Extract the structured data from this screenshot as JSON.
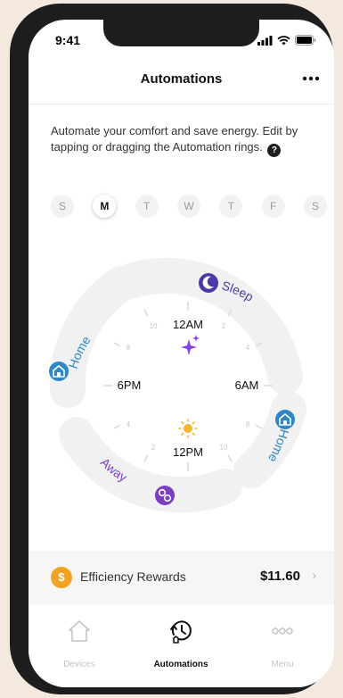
{
  "status_bar": {
    "time": "9:41"
  },
  "header": {
    "title": "Automations"
  },
  "intro": {
    "text": "Automate your comfort and save energy. Edit by tapping or dragging the Automation rings.",
    "help": "?"
  },
  "days": [
    {
      "label": "S",
      "active": false
    },
    {
      "label": "M",
      "active": true
    },
    {
      "label": "T",
      "active": false
    },
    {
      "label": "W",
      "active": false
    },
    {
      "label": "T",
      "active": false
    },
    {
      "label": "F",
      "active": false
    },
    {
      "label": "S",
      "active": false
    }
  ],
  "clock": {
    "labels": {
      "top": "12AM",
      "left": "6PM",
      "right": "6AM",
      "bottom": "12PM"
    },
    "hour_ticks": {
      "ten": "10",
      "two_top": "2",
      "eight_left": "8",
      "four_right": "4",
      "four_left": "4",
      "eight_right": "8",
      "two_bottom": "2",
      "ten_bottom": "10"
    },
    "rings": [
      {
        "name": "Sleep",
        "color": "#4a3aa6"
      },
      {
        "name": "Home",
        "color": "#2d86c8"
      },
      {
        "name": "Away",
        "color": "#7a3fbf"
      },
      {
        "name": "Home",
        "color": "#2d86c8"
      }
    ]
  },
  "rewards": {
    "label": "Efficiency Rewards",
    "value": "$11.60",
    "coin": "$"
  },
  "tabs": [
    {
      "label": "Devices",
      "icon": "home-icon",
      "active": false
    },
    {
      "label": "Automations",
      "icon": "schedule-clock-icon",
      "active": true
    },
    {
      "label": "Menu",
      "icon": "menu-dots-icon",
      "active": false
    }
  ],
  "colors": {
    "sleep": "#4a3aa6",
    "home": "#2d86c8",
    "away": "#7a3fbf",
    "sun": "#f2b632",
    "coin": "#f3a323",
    "stars": "#8a3ff0"
  }
}
